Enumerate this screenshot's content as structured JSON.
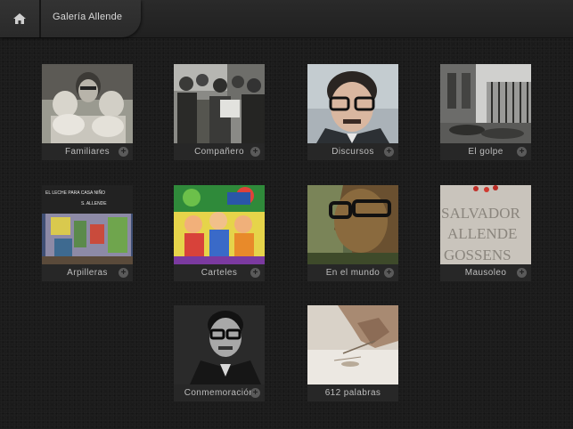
{
  "header": {
    "title": "Galería Allende"
  },
  "tiles": [
    {
      "label": "Familiares",
      "has_plus": true
    },
    {
      "label": "Compañero",
      "has_plus": true
    },
    {
      "label": "Discursos",
      "has_plus": true
    },
    {
      "label": "El golpe",
      "has_plus": true
    },
    {
      "label": "Arpilleras",
      "has_plus": true
    },
    {
      "label": "Carteles",
      "has_plus": true
    },
    {
      "label": "En el mundo",
      "has_plus": true
    },
    {
      "label": "Mausoleo",
      "has_plus": true
    },
    {
      "label": "Conmemoración",
      "has_plus": true
    },
    {
      "label": "612 palabras",
      "has_plus": false
    }
  ],
  "thumbs": {
    "arpillera_text_1": "EL LECHE PARA CASA NIÑO",
    "arpillera_text_2": "S. ALLENDE",
    "mausoleo_text": [
      "SALVADOR",
      "ALLENDE",
      "GOSSENS"
    ]
  },
  "colors": {
    "background": "#1b1b1b",
    "bar": "#2a2a2a",
    "label_text": "#bdbdbd"
  }
}
